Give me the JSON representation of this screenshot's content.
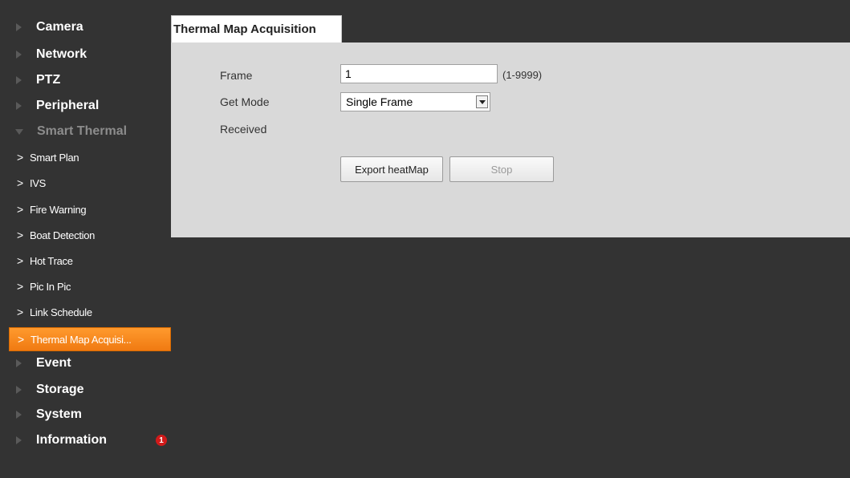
{
  "sidebar": {
    "top_items": [
      {
        "label": "Camera"
      },
      {
        "label": "Network"
      },
      {
        "label": "PTZ"
      },
      {
        "label": "Peripheral"
      },
      {
        "label": "Smart Thermal"
      }
    ],
    "sub_items": [
      {
        "label": "Smart Plan"
      },
      {
        "label": "IVS"
      },
      {
        "label": "Fire Warning"
      },
      {
        "label": "Boat Detection"
      },
      {
        "label": "Hot Trace"
      },
      {
        "label": "Pic In Pic"
      },
      {
        "label": "Link Schedule"
      },
      {
        "label": "Thermal Map Acquisi..."
      }
    ],
    "bottom_items": [
      {
        "label": "Event"
      },
      {
        "label": "Storage"
      },
      {
        "label": "System"
      },
      {
        "label": "Information",
        "badge": "1"
      }
    ],
    "chevron": ">",
    "active_color": "#f7891f"
  },
  "main": {
    "tab_title": "Thermal Map Acquisition",
    "frame_label": "Frame",
    "frame_value": "1",
    "frame_hint": "(1-9999)",
    "get_mode_label": "Get Mode",
    "get_mode_value": "Single Frame",
    "received_label": "Received",
    "export_button": "Export heatMap",
    "stop_button": "Stop"
  }
}
